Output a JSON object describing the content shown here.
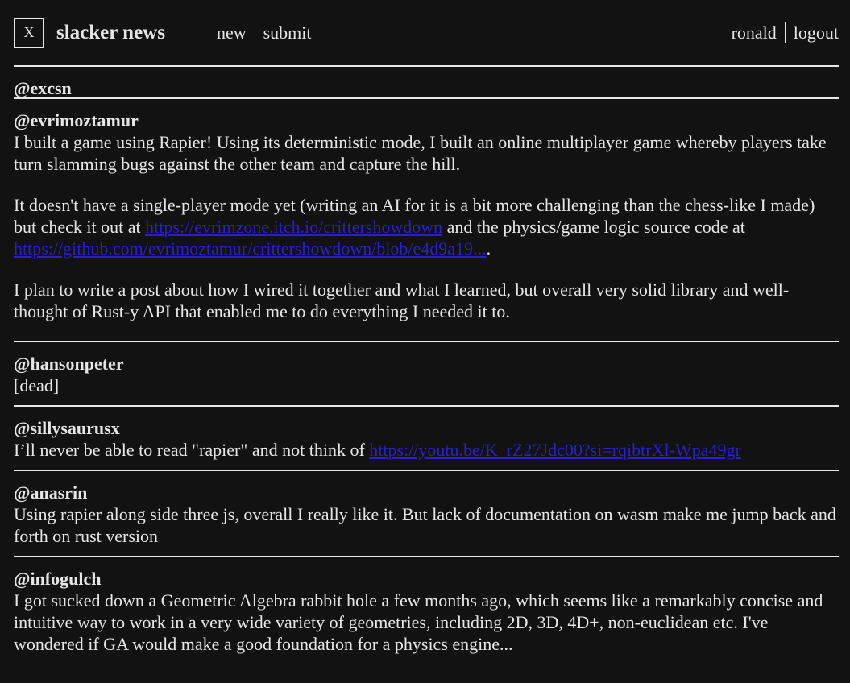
{
  "header": {
    "logo": "X",
    "title": "slacker news",
    "nav": [
      "new",
      "submit"
    ],
    "user": "ronald",
    "logout": "logout"
  },
  "comments": [
    {
      "author": "@excsn"
    },
    {
      "author": "@evrimoztamur",
      "p1": "I built a game using Rapier! Using its deterministic mode, I built an online multiplayer game whereby players take turn slamming bugs against the other team and capture the hill.",
      "p2a": "It doesn't have a single-player mode yet (writing an AI for it is a bit more challenging than the chess-like I made) but check it out at ",
      "link1": "https://evrimzone.itch.io/crittershowdown",
      "p2b": " and the physics/game logic source code at ",
      "link2": "https://github.com/evrimoztamur/crittershowdown/blob/e4d9a19...",
      "p2c": ".",
      "p3": "I plan to write a post about how I wired it together and what I learned, but overall very solid library and well-thought of Rust-y API that enabled me to do everything I needed it to."
    },
    {
      "author": "@hansonpeter",
      "text": "[dead]"
    },
    {
      "author": "@sillysaurusx",
      "text": "I’ll never be able to read \"rapier\" and not think of ",
      "link": "https://youtu.be/K_rZ27Jdc00?si=rqibtrXl-Wpa49gr"
    },
    {
      "author": "@anasrin",
      "text": "Using rapier along side three js, overall I really like it. But lack of documentation on wasm make me jump back and forth on rust version"
    },
    {
      "author": "@infogulch",
      "text": "I got sucked down a Geometric Algebra rabbit hole a few months ago, which seems like a remarkably concise and intuitive way to work in a very wide variety of geometries, including 2D, 3D, 4D+, non-euclidean etc. I've wondered if GA would make a good foundation for a physics engine..."
    }
  ]
}
